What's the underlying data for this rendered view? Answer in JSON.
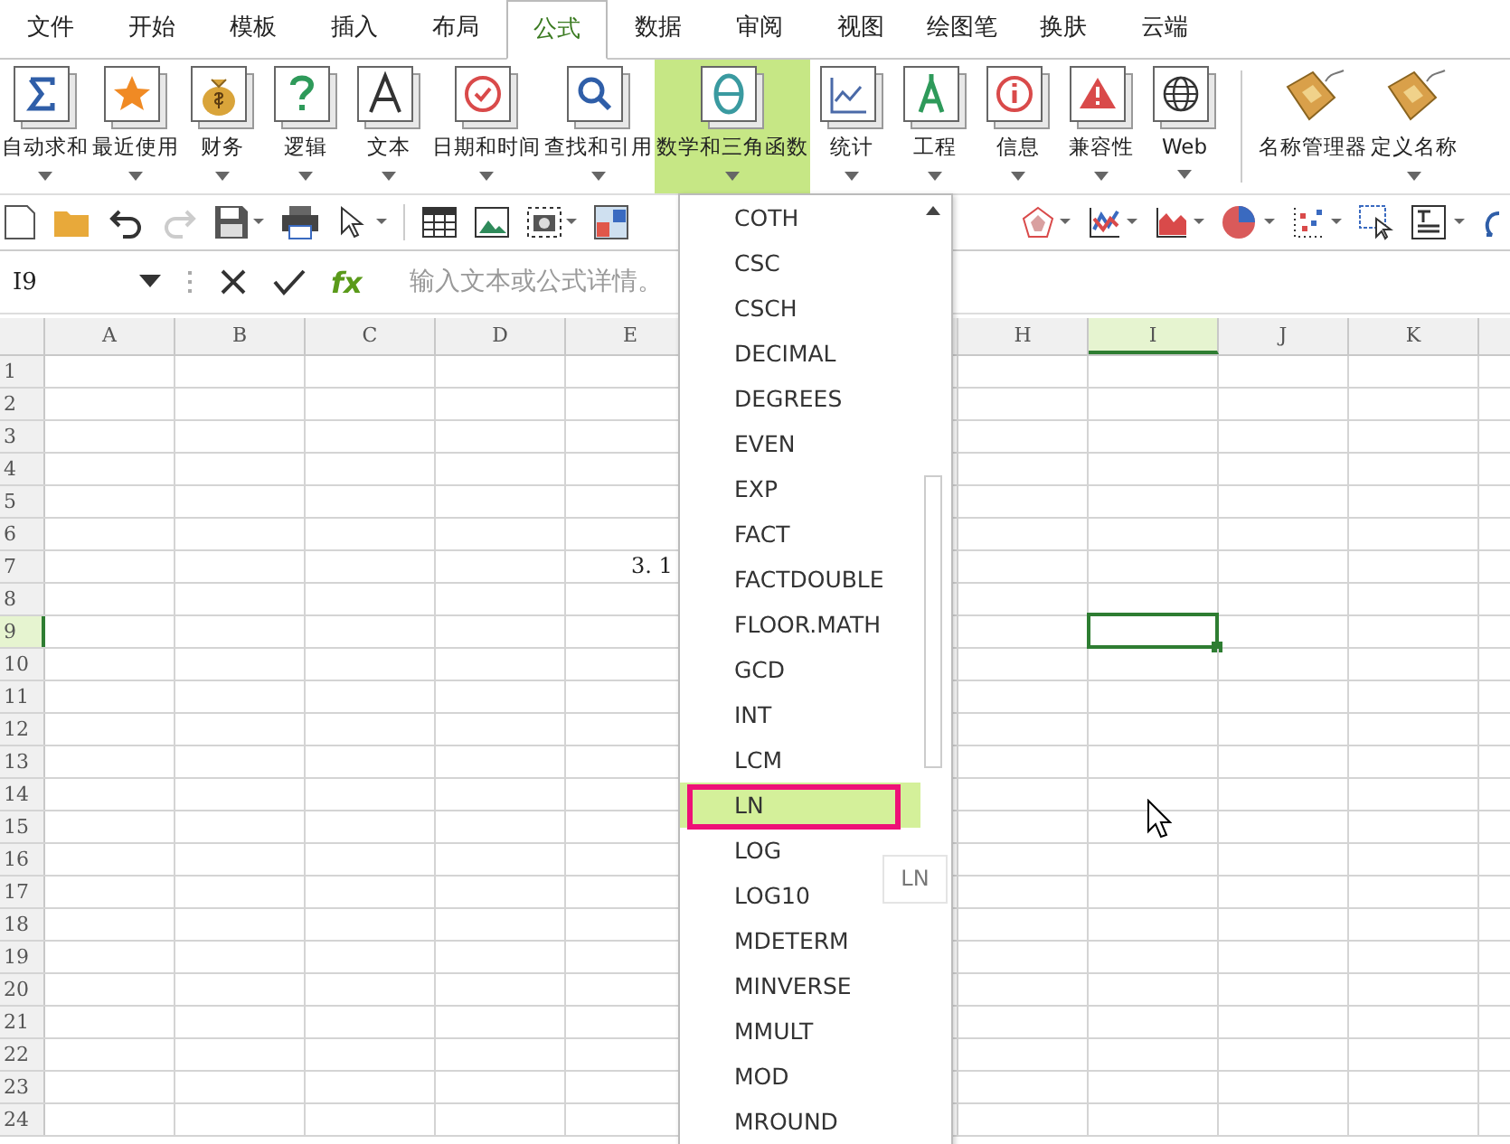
{
  "menu_tabs": [
    {
      "label": "文件",
      "selected": false
    },
    {
      "label": "开始",
      "selected": false
    },
    {
      "label": "模板",
      "selected": false
    },
    {
      "label": "插入",
      "selected": false
    },
    {
      "label": "布局",
      "selected": false
    },
    {
      "label": "公式",
      "selected": true
    },
    {
      "label": "数据",
      "selected": false
    },
    {
      "label": "审阅",
      "selected": false
    },
    {
      "label": "视图",
      "selected": false
    },
    {
      "label": "绘图笔",
      "selected": false
    },
    {
      "label": "换肤",
      "selected": false
    },
    {
      "label": "云端",
      "selected": false
    }
  ],
  "ribbon_buttons": [
    {
      "label": "自动求和",
      "selected": false,
      "dropdown": true
    },
    {
      "label": "最近使用",
      "selected": false,
      "dropdown": true
    },
    {
      "label": "财务",
      "selected": false,
      "dropdown": true
    },
    {
      "label": "逻辑",
      "selected": false,
      "dropdown": true
    },
    {
      "label": "文本",
      "selected": false,
      "dropdown": true
    },
    {
      "label": "日期和时间",
      "selected": false,
      "dropdown": true
    },
    {
      "label": "查找和引用",
      "selected": false,
      "dropdown": true
    },
    {
      "label": "数学和三角函数",
      "selected": true,
      "dropdown": true
    },
    {
      "label": "统计",
      "selected": false,
      "dropdown": true
    },
    {
      "label": "工程",
      "selected": false,
      "dropdown": true
    },
    {
      "label": "信息",
      "selected": false,
      "dropdown": true
    },
    {
      "label": "兼容性",
      "selected": false,
      "dropdown": true
    },
    {
      "label": "Web",
      "selected": false,
      "dropdown": true
    }
  ],
  "ribbon_buttons_right": [
    {
      "label": "名称管理器",
      "dropdown": false
    },
    {
      "label": "定义名称",
      "dropdown": true
    }
  ],
  "formula_bar": {
    "name_box": "I9",
    "fx": "fx",
    "placeholder": "输入文本或公式详情。"
  },
  "sheet": {
    "columns_left": [
      {
        "label": "A",
        "selected": false
      },
      {
        "label": "B",
        "selected": false
      },
      {
        "label": "C",
        "selected": false
      },
      {
        "label": "D",
        "selected": false
      },
      {
        "label": "E",
        "selected": false
      }
    ],
    "columns_right": [
      {
        "label": "H",
        "selected": false
      },
      {
        "label": "I",
        "selected": true
      },
      {
        "label": "J",
        "selected": false
      },
      {
        "label": "K",
        "selected": false
      }
    ],
    "rows": [
      {
        "label": "1",
        "selected": false
      },
      {
        "label": "2",
        "selected": false
      },
      {
        "label": "3",
        "selected": false
      },
      {
        "label": "4",
        "selected": false
      },
      {
        "label": "5",
        "selected": false
      },
      {
        "label": "6",
        "selected": false
      },
      {
        "label": "7",
        "selected": false,
        "value": "3. 1"
      },
      {
        "label": "8",
        "selected": false
      },
      {
        "label": "9",
        "selected": true
      },
      {
        "label": "10",
        "selected": false
      },
      {
        "label": "11",
        "selected": false
      },
      {
        "label": "12",
        "selected": false
      },
      {
        "label": "13",
        "selected": false
      },
      {
        "label": "14",
        "selected": false
      },
      {
        "label": "15",
        "selected": false
      },
      {
        "label": "16",
        "selected": false
      },
      {
        "label": "17",
        "selected": false
      },
      {
        "label": "18",
        "selected": false
      },
      {
        "label": "19",
        "selected": false
      },
      {
        "label": "20",
        "selected": false
      },
      {
        "label": "21",
        "selected": false
      },
      {
        "label": "22",
        "selected": false
      },
      {
        "label": "23",
        "selected": false
      },
      {
        "label": "24",
        "selected": false
      }
    ]
  },
  "function_menu": {
    "items": [
      {
        "label": "COTH",
        "selected": false
      },
      {
        "label": "CSC",
        "selected": false
      },
      {
        "label": "CSCH",
        "selected": false
      },
      {
        "label": "DECIMAL",
        "selected": false
      },
      {
        "label": "DEGREES",
        "selected": false
      },
      {
        "label": "EVEN",
        "selected": false
      },
      {
        "label": "EXP",
        "selected": false
      },
      {
        "label": "FACT",
        "selected": false
      },
      {
        "label": "FACTDOUBLE",
        "selected": false
      },
      {
        "label": "FLOOR.MATH",
        "selected": false
      },
      {
        "label": "GCD",
        "selected": false
      },
      {
        "label": "INT",
        "selected": false
      },
      {
        "label": "LCM",
        "selected": false
      },
      {
        "label": "LN",
        "selected": true
      },
      {
        "label": "LOG",
        "selected": false
      },
      {
        "label": "LOG10",
        "selected": false
      },
      {
        "label": "MDETERM",
        "selected": false
      },
      {
        "label": "MINVERSE",
        "selected": false
      },
      {
        "label": "MMULT",
        "selected": false
      },
      {
        "label": "MOD",
        "selected": false
      },
      {
        "label": "MROUND",
        "selected": false
      }
    ],
    "tooltip": "LN"
  }
}
